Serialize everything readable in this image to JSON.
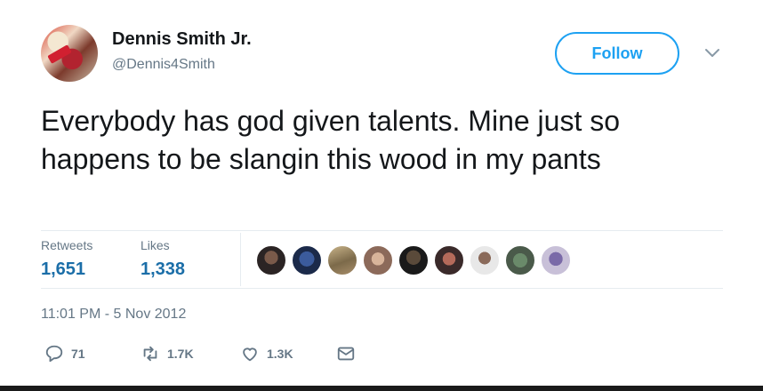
{
  "user": {
    "display_name": "Dennis Smith Jr.",
    "handle": "@Dennis4Smith"
  },
  "follow_label": "Follow",
  "tweet_text": "Everybody has god given talents. Mine just so happens to be slangin this wood in my pants",
  "stats": {
    "retweets_label": "Retweets",
    "retweets_value": "1,651",
    "likes_label": "Likes",
    "likes_value": "1,338"
  },
  "likers_count": 9,
  "timestamp": "11:01 PM - 5 Nov 2012",
  "actions": {
    "reply_count": "71",
    "retweet_count": "1.7K",
    "like_count": "1.3K"
  },
  "colors": {
    "accent": "#1da1f2",
    "stat_value": "#1b6ea8",
    "muted": "#657786",
    "text": "#14171a"
  }
}
